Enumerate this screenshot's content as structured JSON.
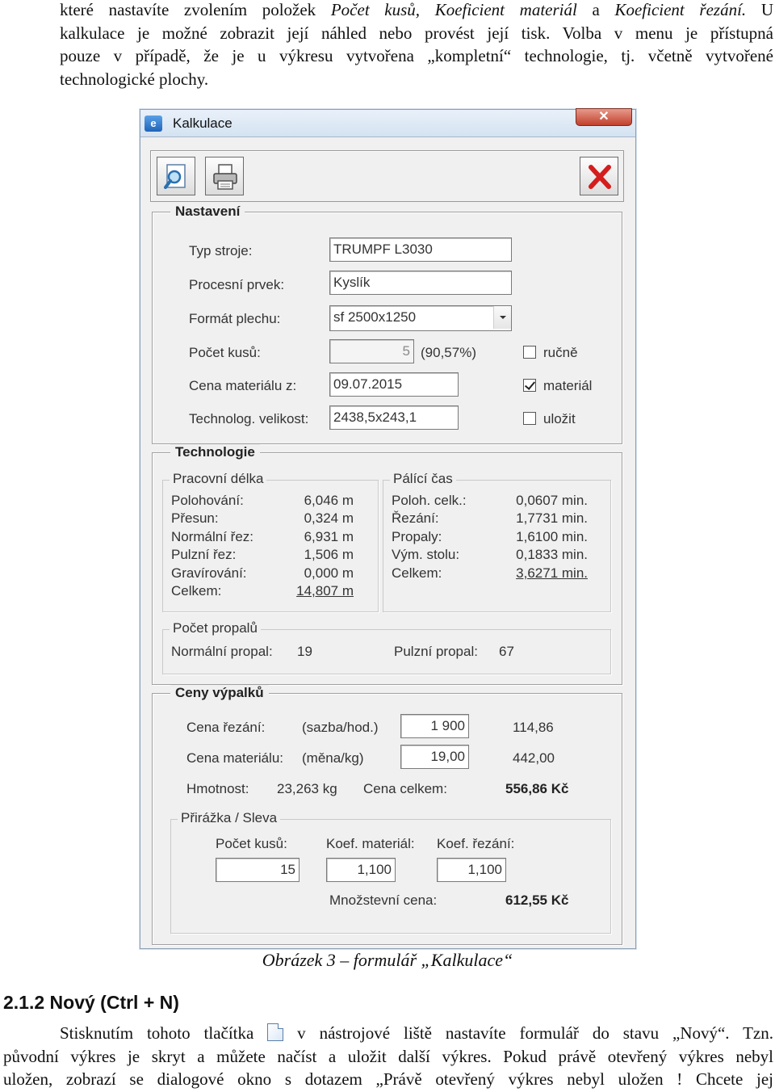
{
  "intro": {
    "line1_a": "které nastavíte zvolením položek ",
    "line1_b": "Počet kusů, Koeficient materiál",
    "line1_c": " a ",
    "line1_d": "Koeficient řezání.",
    "line1_e": " U",
    "line2": "kalkulace je možné zobrazit její náhled  nebo provést její tisk. Volba v menu je přístupná",
    "line3": "pouze v případě, že je u výkresu vytvořena „kompletní“ technologie, tj. včetně vytvořené",
    "line4": "technologické plochy."
  },
  "window": {
    "title": "Kalkulace",
    "app_icon": "app-icon",
    "close_glyph": "✕",
    "toolbar": {
      "preview_icon": "preview-magnifier-icon",
      "print_icon": "printer-icon",
      "close_icon": "red-x-icon"
    },
    "settings": {
      "title": "Nastavení",
      "machine_label": "Typ stroje:",
      "machine_value": "TRUMPF L3030",
      "process_label": "Procesní prvek:",
      "process_value": "Kyslík",
      "sheet_label": "Formát plechu:",
      "sheet_value": "sf 2500x1250",
      "count_label": "Počet kusů:",
      "count_value": "5",
      "count_pct": "(90,57%)",
      "price_date_label": "Cena materiálu z:",
      "price_date_value": "09.07.2015",
      "tech_size_label": "Technolog. velikost:",
      "tech_size_value": "2438,5x243,1",
      "chk_manual_label": "ručně",
      "chk_manual": false,
      "chk_material_label": "materiál",
      "chk_material": true,
      "chk_save_label": "uložit",
      "chk_save": false
    },
    "technology": {
      "title": "Technologie",
      "length_title": "Pracovní délka",
      "length_rows": [
        {
          "label": "Polohování:",
          "value": "6,046 m"
        },
        {
          "label": "Přesun:",
          "value": "0,324 m"
        },
        {
          "label": "Normální řez:",
          "value": "6,931 m"
        },
        {
          "label": "Pulzní řez:",
          "value": "1,506 m"
        },
        {
          "label": "Gravírování:",
          "value": "0,000 m"
        },
        {
          "label": "Celkem:",
          "value": "14,807 m"
        }
      ],
      "time_title": "Pálící čas",
      "time_rows": [
        {
          "label": "Poloh. celk.:",
          "value": "0,0607 min."
        },
        {
          "label": "Řezání:",
          "value": "1,7731 min."
        },
        {
          "label": "Propaly:",
          "value": "1,6100 min."
        },
        {
          "label": "Vým. stolu:",
          "value": "0,1833 min."
        },
        {
          "label": "Celkem:",
          "value": "3,6271 min."
        }
      ],
      "pierce_title": "Počet propalů",
      "normal_pierce_label": "Normální propal:",
      "normal_pierce_value": "19",
      "pulse_pierce_label": "Pulzní propal:",
      "pulse_pierce_value": "67"
    },
    "prices": {
      "title": "Ceny výpalků",
      "cut_label": "Cena řezání:",
      "cut_unit": "(sazba/hod.)",
      "cut_rate": "1 900",
      "cut_total": "114,86",
      "mat_label": "Cena materiálu:",
      "mat_unit": "(měna/kg)",
      "mat_rate": "19,00",
      "mat_total": "442,00",
      "weight_label": "Hmotnost:",
      "weight_value": "23,263 kg",
      "total_label": "Cena celkem:",
      "total_value": "556,86 Kč",
      "surcharge_title": "Přirážka / Sleva",
      "pcs_label": "Počet kusů:",
      "pcs_value": "15",
      "kmat_label": "Koef. materiál:",
      "kmat_value": "1,100",
      "kcut_label": "Koef. řezání:",
      "kcut_value": "1,100",
      "qty_price_label": "Množstevní cena:",
      "qty_price_value": "612,55 Kč"
    }
  },
  "caption": "Obrázek 3 – formulář „Kalkulace“",
  "section_heading": "2.1.2 Nový (Ctrl + N)",
  "body": {
    "line1_a": "Stisknutím tohoto tlačítka ",
    "new_icon": "new-document-icon",
    "line1_b": " v nástrojové liště nastavíte formulář do stavu „Nový“. Tzn.",
    "line2": "původní výkres je skryt a můžete načíst a uložit další výkres. Pokud právě otevřený výkres nebyl",
    "line3": "uložen, zobrazí se dialogové okno s dotazem „Právě otevřený výkres nebyl uložen ! Chcete jej"
  }
}
